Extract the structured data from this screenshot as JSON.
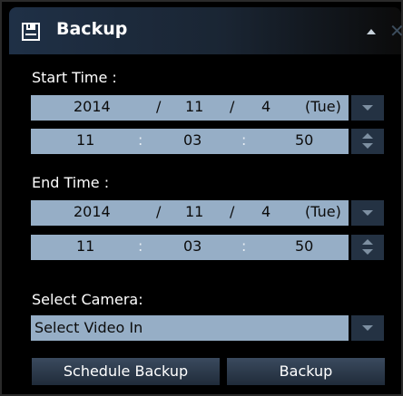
{
  "window": {
    "title": "Backup"
  },
  "start_time": {
    "label": "Start Time :",
    "date": {
      "year": "2014",
      "month": "11",
      "day": "4",
      "weekday": "(Tue)",
      "separator": "/"
    },
    "time": {
      "hour": "11",
      "minute": "03",
      "second": "50",
      "separator": ":"
    }
  },
  "end_time": {
    "label": "End Time :",
    "date": {
      "year": "2014",
      "month": "11",
      "day": "4",
      "weekday": "(Tue)",
      "separator": "/"
    },
    "time": {
      "hour": "11",
      "minute": "03",
      "second": "50",
      "separator": ":"
    }
  },
  "camera": {
    "label": "Select Camera:",
    "selected": "Select Video In"
  },
  "actions": {
    "schedule_backup": "Schedule Backup",
    "backup": "Backup"
  },
  "colors": {
    "panel_bg": "#000000",
    "field_bg": "#96aec6",
    "header_accent": "#1f3046",
    "button_bg": "#2b394a"
  },
  "icons": {
    "app": "floppy-save-icon",
    "collapse": "collapse-up-icon",
    "close": "close-icon",
    "dropdown": "chevron-down-icon",
    "spinner": "spinner-updown-icon"
  }
}
